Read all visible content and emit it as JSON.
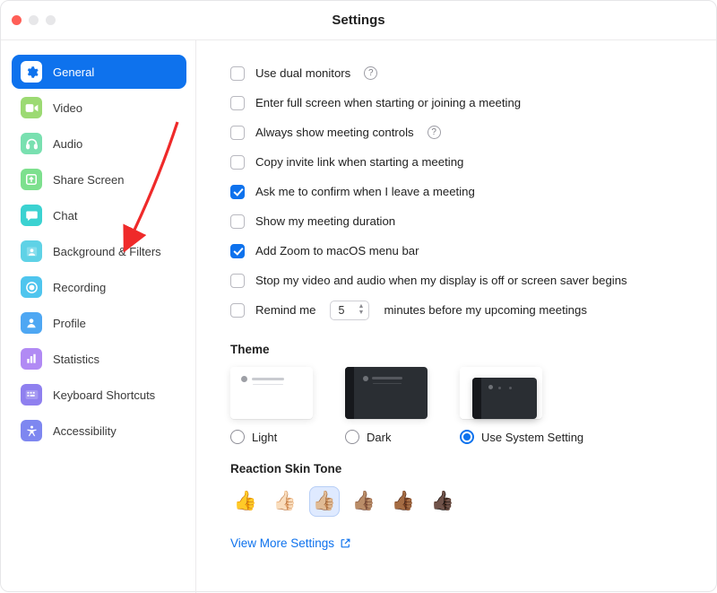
{
  "window": {
    "title": "Settings"
  },
  "sidebar": {
    "items": [
      {
        "label": "General",
        "active": true,
        "color": "#ffffff",
        "icon": "gear"
      },
      {
        "label": "Video",
        "active": false,
        "color": "#9cda73",
        "icon": "video"
      },
      {
        "label": "Audio",
        "active": false,
        "color": "#79e0b0",
        "icon": "headphones"
      },
      {
        "label": "Share Screen",
        "active": false,
        "color": "#7de08e",
        "icon": "share"
      },
      {
        "label": "Chat",
        "active": false,
        "color": "#3bd2d1",
        "icon": "chat"
      },
      {
        "label": "Background & Filters",
        "active": false,
        "color": "#5fd2e6",
        "icon": "person-card"
      },
      {
        "label": "Recording",
        "active": false,
        "color": "#4fc5ee",
        "icon": "record"
      },
      {
        "label": "Profile",
        "active": false,
        "color": "#4ea7f3",
        "icon": "person"
      },
      {
        "label": "Statistics",
        "active": false,
        "color": "#b18af4",
        "icon": "stats"
      },
      {
        "label": "Keyboard Shortcuts",
        "active": false,
        "color": "#8f80ef",
        "icon": "keyboard"
      },
      {
        "label": "Accessibility",
        "active": false,
        "color": "#7e87f0",
        "icon": "accessibility"
      }
    ]
  },
  "general": {
    "options": [
      {
        "label": "Use dual monitors",
        "checked": false,
        "info": true
      },
      {
        "label": "Enter full screen when starting or joining a meeting",
        "checked": false
      },
      {
        "label": "Always show meeting controls",
        "checked": false,
        "info": true
      },
      {
        "label": "Copy invite link when starting a meeting",
        "checked": false
      },
      {
        "label": "Ask me to confirm when I leave a meeting",
        "checked": true
      },
      {
        "label": "Show my meeting duration",
        "checked": false
      },
      {
        "label": "Add Zoom to macOS menu bar",
        "checked": true
      },
      {
        "label": "Stop my video and audio when my display is off or screen saver begins",
        "checked": false
      }
    ],
    "remind": {
      "prefix": "Remind me",
      "value": "5",
      "suffix": "minutes before my upcoming meetings",
      "checked": false
    },
    "theme": {
      "title": "Theme",
      "options": [
        {
          "label": "Light",
          "value": "light",
          "selected": false
        },
        {
          "label": "Dark",
          "value": "dark",
          "selected": false
        },
        {
          "label": "Use System Setting",
          "value": "system",
          "selected": true
        }
      ]
    },
    "skinTone": {
      "title": "Reaction Skin Tone",
      "tones": [
        "👍",
        "👍🏻",
        "👍🏼",
        "👍🏽",
        "👍🏾",
        "👍🏿"
      ],
      "selectedIndex": 2
    },
    "moreLink": "View More Settings"
  },
  "annotation": {
    "arrowTarget": "sidebar-item-background-filters"
  }
}
